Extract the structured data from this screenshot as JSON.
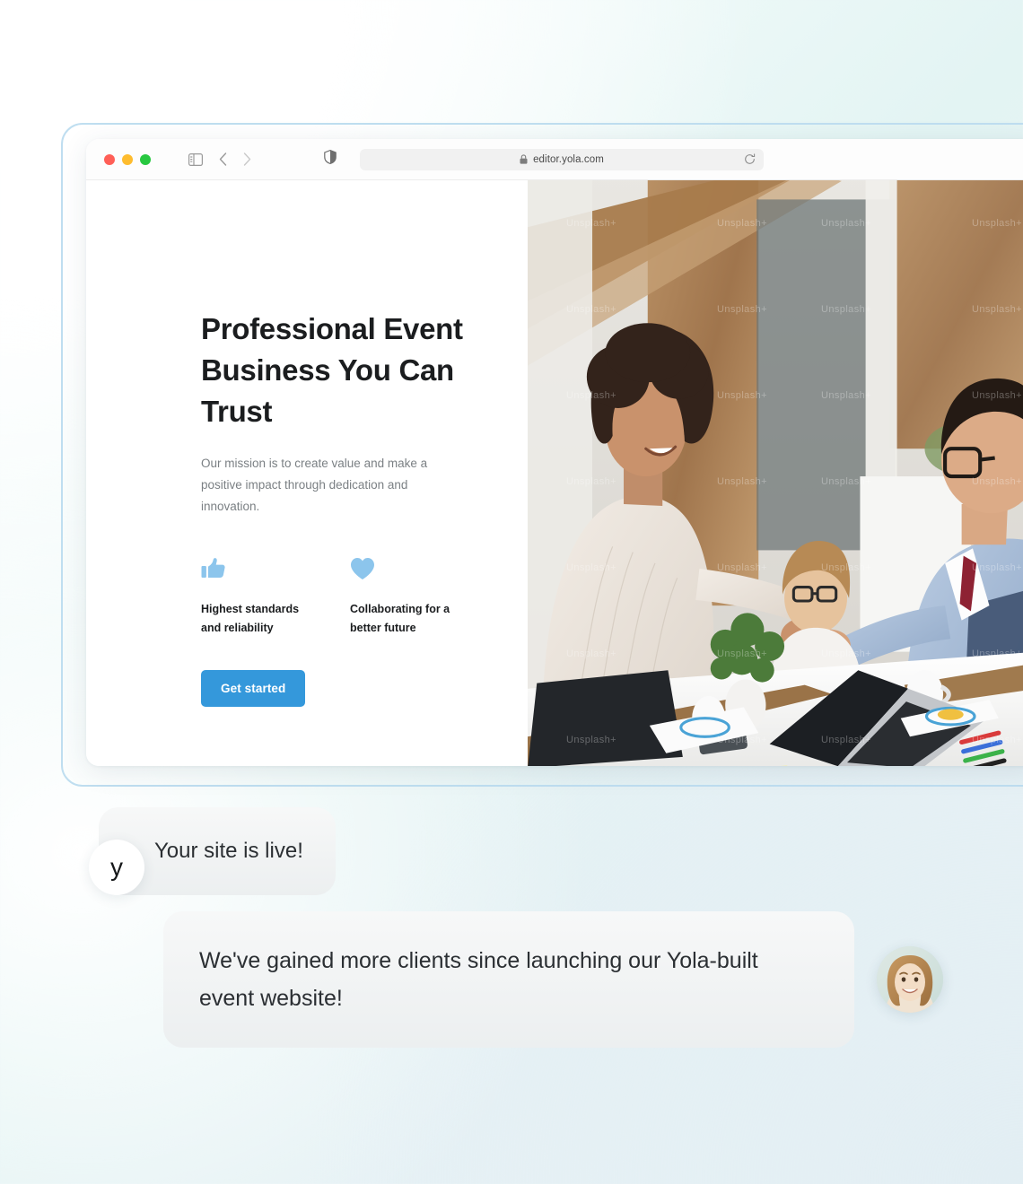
{
  "browser": {
    "url": "editor.yola.com",
    "traffic_lights": [
      "close-red",
      "minimize-yellow",
      "maximize-green"
    ],
    "icons": {
      "sidebar_toggle": "sidebar-toggle-icon",
      "back": "back-chevron-icon",
      "forward": "forward-chevron-icon",
      "shield": "shield-icon",
      "lock": "lock-icon",
      "reload": "reload-icon"
    }
  },
  "site": {
    "heading": "Professional Event Business You Can Trust",
    "subtext": "Our mission is to create value and make a positive impact through dedication and innovation.",
    "features": [
      {
        "icon": "thumbs-up-icon",
        "title": "Highest standards and reliability"
      },
      {
        "icon": "heart-icon",
        "title": "Collaborating for a better future"
      }
    ],
    "cta_label": "Get started",
    "photo_alt": "business-handshake-office-photo",
    "photo_watermark": "Unsplash+"
  },
  "chat": {
    "messages": [
      {
        "avatar": "yola-logo-y",
        "text": "Your site is live!"
      },
      {
        "avatar": "user-photo-avatar",
        "text": "We've gained more clients since launching our Yola-built event website!"
      }
    ]
  },
  "colors": {
    "accent_blue": "#3498db",
    "icon_blue": "#8cc5ec",
    "frame_border": "#bfdef0",
    "bubble_gray": "#eceff0",
    "heading_dark": "#1b1d1f",
    "body_gray": "#7b8084"
  }
}
